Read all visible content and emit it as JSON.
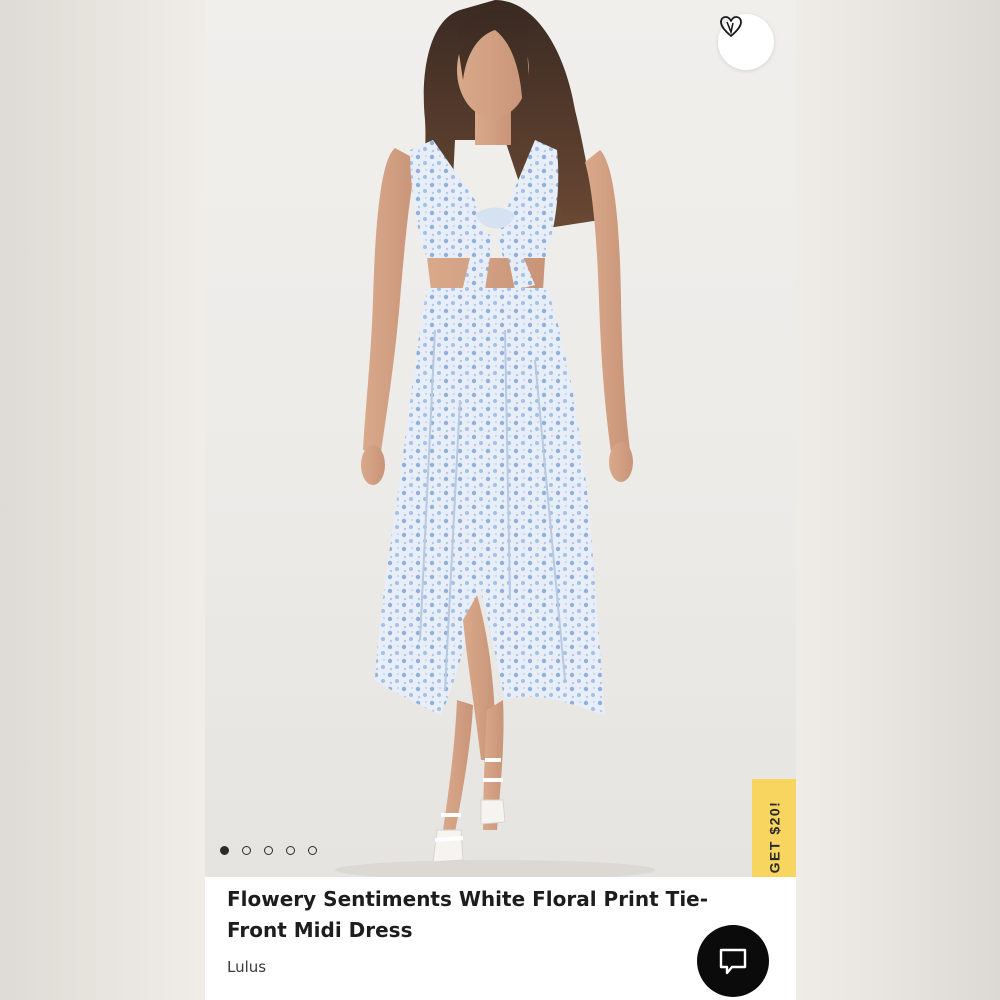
{
  "product": {
    "title": "Flowery Sentiments White Floral Print Tie-Front Midi Dress",
    "brand": "Lulus",
    "image_alt": "Model wearing light blue floral print tie-front midi dress with white strappy sandals"
  },
  "gallery": {
    "total_images": 5,
    "active_index": 1
  },
  "promo": {
    "label": "GET $20!",
    "color": "#f7d55f"
  },
  "icons": {
    "favorite": "heart-icon",
    "chat": "chat-bubble-icon"
  },
  "colors": {
    "dress": "#c9d8ec",
    "accent": "#f7d55f",
    "chat_button": "#0b0b0b"
  }
}
